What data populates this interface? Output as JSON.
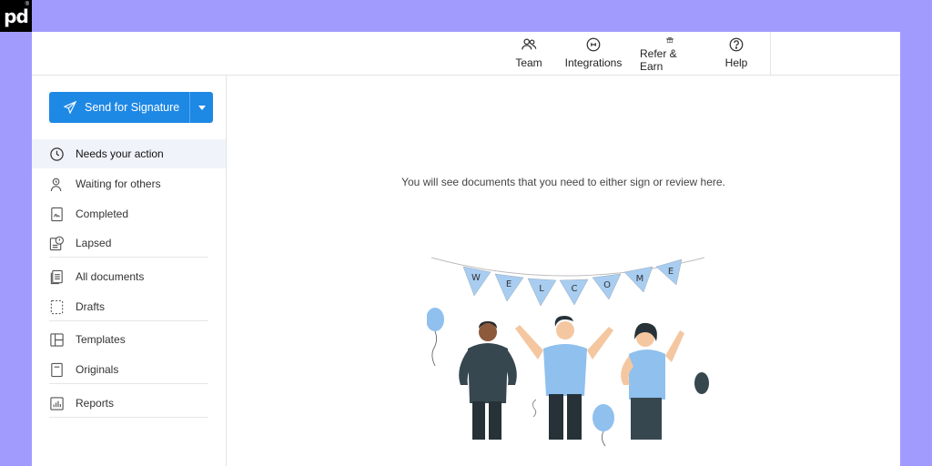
{
  "topnav": {
    "items": [
      {
        "label": "Team",
        "icon": "team-icon"
      },
      {
        "label": "Integrations",
        "icon": "integrations-icon"
      },
      {
        "label": "Refer & Earn",
        "icon": "gift-icon"
      },
      {
        "label": "Help",
        "icon": "help-icon"
      }
    ]
  },
  "send_button": {
    "label": "Send for Signature",
    "color": "#1e88e5"
  },
  "sidebar": {
    "items": [
      {
        "label": "Needs your action",
        "icon": "clock-icon",
        "active": true
      },
      {
        "label": "Waiting for others",
        "icon": "user-clock-icon"
      },
      {
        "label": "Completed",
        "icon": "completed-doc-icon"
      },
      {
        "label": "Lapsed",
        "icon": "lapsed-doc-icon"
      },
      {
        "label": "All documents",
        "icon": "documents-icon"
      },
      {
        "label": "Drafts",
        "icon": "draft-icon"
      },
      {
        "label": "Templates",
        "icon": "template-icon"
      },
      {
        "label": "Originals",
        "icon": "original-doc-icon"
      },
      {
        "label": "Reports",
        "icon": "reports-icon"
      }
    ]
  },
  "main": {
    "empty_message": "You will see documents that you need to either sign or review here.",
    "banner_letters": [
      "W",
      "E",
      "L",
      "C",
      "O",
      "M",
      "E"
    ]
  },
  "colors": {
    "background": "#a29bfe",
    "accent": "#1e88e5",
    "active_row": "#f0f4fa",
    "banner": "#a8cdf0"
  }
}
